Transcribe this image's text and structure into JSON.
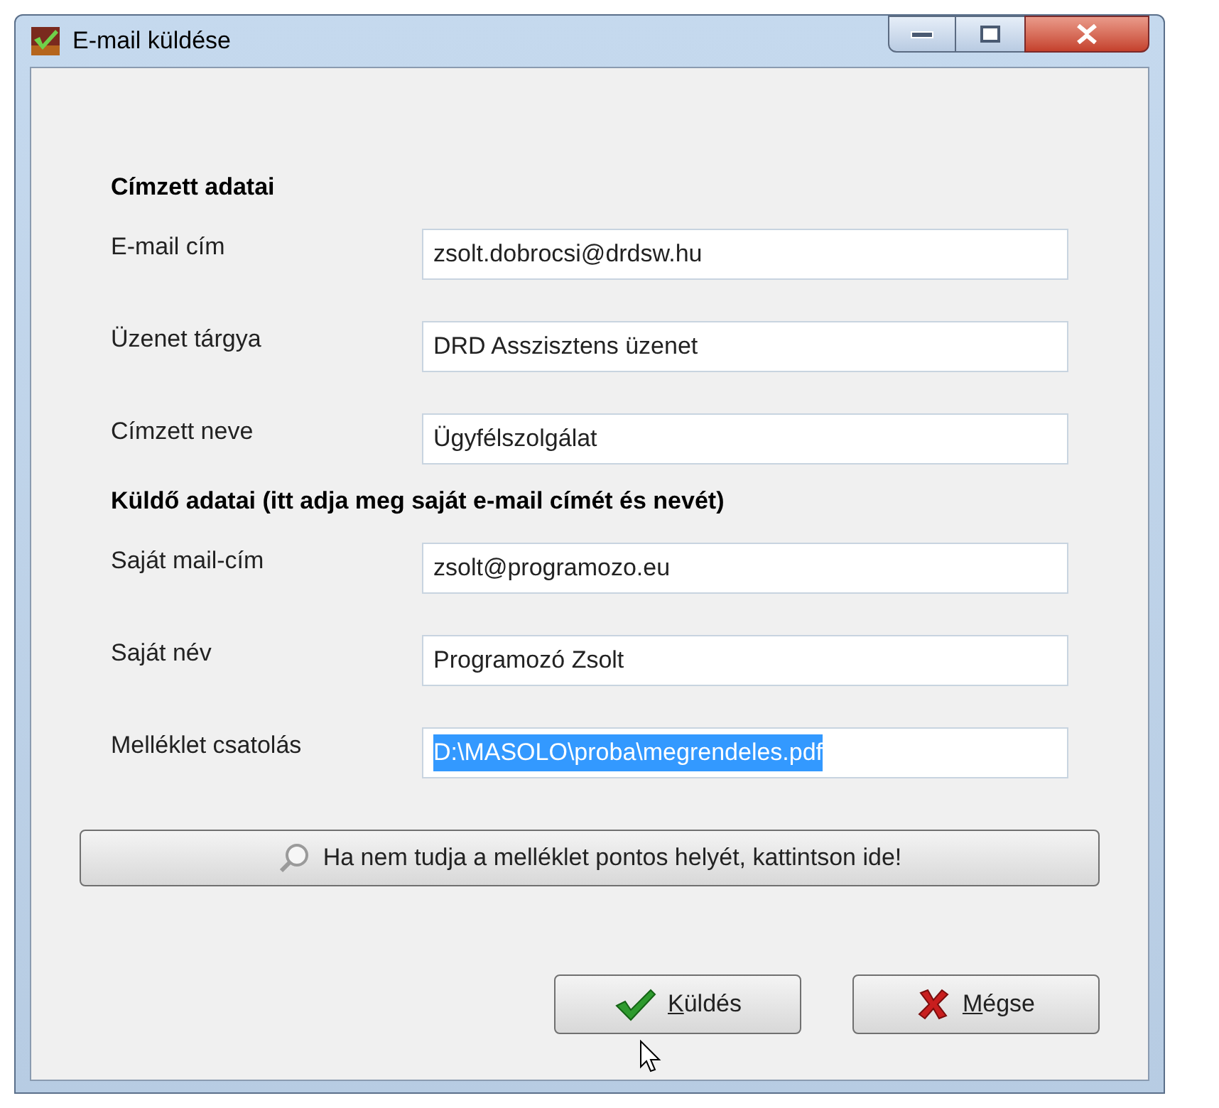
{
  "window": {
    "title": "E-mail küldése"
  },
  "sections": [
    {
      "heading": "Címzett adatai",
      "fields": [
        {
          "label": "E-mail cím",
          "value": "zsolt.dobrocsi@drdsw.hu",
          "selected": false
        },
        {
          "label": "Üzenet tárgya",
          "value": "DRD Asszisztens üzenet",
          "selected": false
        },
        {
          "label": "Címzett neve",
          "value": "Ügyfélszolgálat",
          "selected": false
        }
      ]
    },
    {
      "heading": "Küldő adatai (itt adja meg saját e-mail címét és nevét)",
      "fields": [
        {
          "label": "Saját mail-cím",
          "value": "zsolt@programozo.eu",
          "selected": false
        },
        {
          "label": "Saját név",
          "value": "Programozó Zsolt",
          "selected": false
        },
        {
          "label": "Melléklet csatolás",
          "value": "D:\\MASOLO\\proba\\megrendeles.pdf",
          "selected": true
        }
      ]
    }
  ],
  "browse_button": {
    "label": "Ha nem tudja a melléklet pontos helyét, kattintson ide!"
  },
  "buttons": [
    {
      "kind": "ok",
      "label": "Küldés",
      "mnemonic": true
    },
    {
      "kind": "cancel",
      "label": "Mégse",
      "mnemonic": true
    }
  ]
}
